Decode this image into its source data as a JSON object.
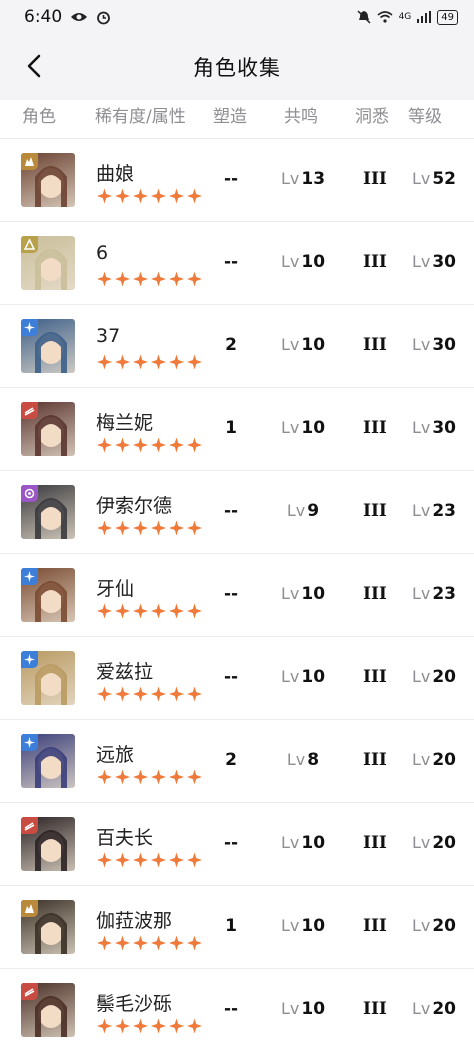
{
  "status_bar": {
    "time": "6:40",
    "network": "4G",
    "battery": "49"
  },
  "nav": {
    "title": "角色收集"
  },
  "headers": {
    "role": "角色",
    "rarity": "稀有度/属性",
    "refine": "塑造",
    "resonance": "共鸣",
    "familiarity": "洞悉",
    "level": "等级"
  },
  "lv_prefix": "Lv",
  "colors": {
    "star": "#f07a3a",
    "header_text": "#8e8e93",
    "bar_bg": "#f4f4f6"
  },
  "characters": [
    {
      "name": "曲娘",
      "stars": 6,
      "element": "mineral",
      "refine": "--",
      "resonance": "13",
      "familiarity": "III",
      "level": "52",
      "avatar_bg": "#6b4233",
      "elem_color": "#b98a3c"
    },
    {
      "name": "6",
      "stars": 6,
      "element": "plant",
      "refine": "--",
      "resonance": "10",
      "familiarity": "III",
      "level": "30",
      "avatar_bg": "#c9bf9a",
      "elem_color": "#b8a14a"
    },
    {
      "name": "37",
      "stars": 6,
      "element": "star",
      "refine": "2",
      "resonance": "10",
      "familiarity": "III",
      "level": "30",
      "avatar_bg": "#3d5f88",
      "elem_color": "#3d7fd8"
    },
    {
      "name": "梅兰妮",
      "stars": 6,
      "element": "beast",
      "refine": "1",
      "resonance": "10",
      "familiarity": "III",
      "level": "30",
      "avatar_bg": "#5a3530",
      "elem_color": "#c94c42"
    },
    {
      "name": "伊索尔德",
      "stars": 6,
      "element": "spirit",
      "refine": "--",
      "resonance": "9",
      "familiarity": "III",
      "level": "23",
      "avatar_bg": "#3a3a3e",
      "elem_color": "#9a55c6"
    },
    {
      "name": "牙仙",
      "stars": 6,
      "element": "star",
      "refine": "--",
      "resonance": "10",
      "familiarity": "III",
      "level": "23",
      "avatar_bg": "#7a4b32",
      "elem_color": "#3d7fd8"
    },
    {
      "name": "爱兹拉",
      "stars": 6,
      "element": "star",
      "refine": "--",
      "resonance": "10",
      "familiarity": "III",
      "level": "20",
      "avatar_bg": "#b99a62",
      "elem_color": "#3d7fd8"
    },
    {
      "name": "远旅",
      "stars": 6,
      "element": "star",
      "refine": "2",
      "resonance": "8",
      "familiarity": "III",
      "level": "20",
      "avatar_bg": "#3b3f7a",
      "elem_color": "#3d7fd8"
    },
    {
      "name": "百夫长",
      "stars": 6,
      "element": "beast",
      "refine": "--",
      "resonance": "10",
      "familiarity": "III",
      "level": "20",
      "avatar_bg": "#2b2225",
      "elem_color": "#c94c42"
    },
    {
      "name": "伽菈波那",
      "stars": 6,
      "element": "mineral",
      "refine": "1",
      "resonance": "10",
      "familiarity": "III",
      "level": "20",
      "avatar_bg": "#3a3026",
      "elem_color": "#b98a3c"
    },
    {
      "name": "鬃毛沙砾",
      "stars": 6,
      "element": "beast",
      "refine": "--",
      "resonance": "10",
      "familiarity": "III",
      "level": "20",
      "avatar_bg": "#4a2f26",
      "elem_color": "#c94c42"
    }
  ]
}
